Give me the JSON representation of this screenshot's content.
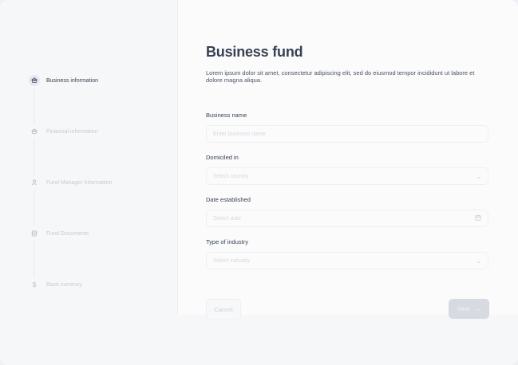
{
  "sidebar": {
    "steps": [
      {
        "label": "Business information",
        "icon": "bank-icon",
        "active": true
      },
      {
        "label": "Financial information",
        "icon": "bank-icon",
        "active": false
      },
      {
        "label": "Fund Manager Information",
        "icon": "user-icon",
        "active": false
      },
      {
        "label": "Fund Documents",
        "icon": "database-icon",
        "active": false
      },
      {
        "label": "Base currency",
        "icon": "dollar-icon",
        "active": false
      }
    ]
  },
  "main": {
    "title": "Business fund",
    "intro": "Lorem ipsum dolor sit amet, consectetur adipiscing elit, sed do eiusmod tempor incididunt ut labore et dolore magna aliqua.",
    "fields": {
      "business_name": {
        "label": "Business name",
        "placeholder": "Enter business name"
      },
      "domiciled_in": {
        "label": "Domiciled in",
        "placeholder": "Select country"
      },
      "date_established": {
        "label": "Date established",
        "placeholder": "Select date"
      },
      "industry": {
        "label": "Type of industry",
        "placeholder": "Select industry"
      }
    },
    "buttons": {
      "cancel": "Cancel",
      "next": "Next"
    }
  },
  "colors": {
    "accent": "#374151",
    "disabled_button": "#d7dae0"
  }
}
